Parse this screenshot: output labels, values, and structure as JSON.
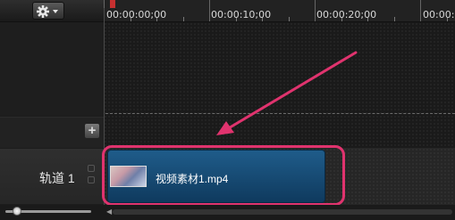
{
  "toolbar": {
    "gear_icon": "gear-icon",
    "dropdown_icon": "caret-down-icon"
  },
  "ruler": {
    "timecodes": [
      "00:00:00;00",
      "00:00:10;00",
      "00:00:20;00",
      "00:00:3"
    ]
  },
  "track": {
    "label": "轨道 1",
    "add_icon": "+"
  },
  "clip": {
    "name": "视频素材1.mp4"
  },
  "colors": {
    "clip_fill": "#1f5c8a",
    "highlight": "#e0336e",
    "playhead": "#c63030"
  }
}
